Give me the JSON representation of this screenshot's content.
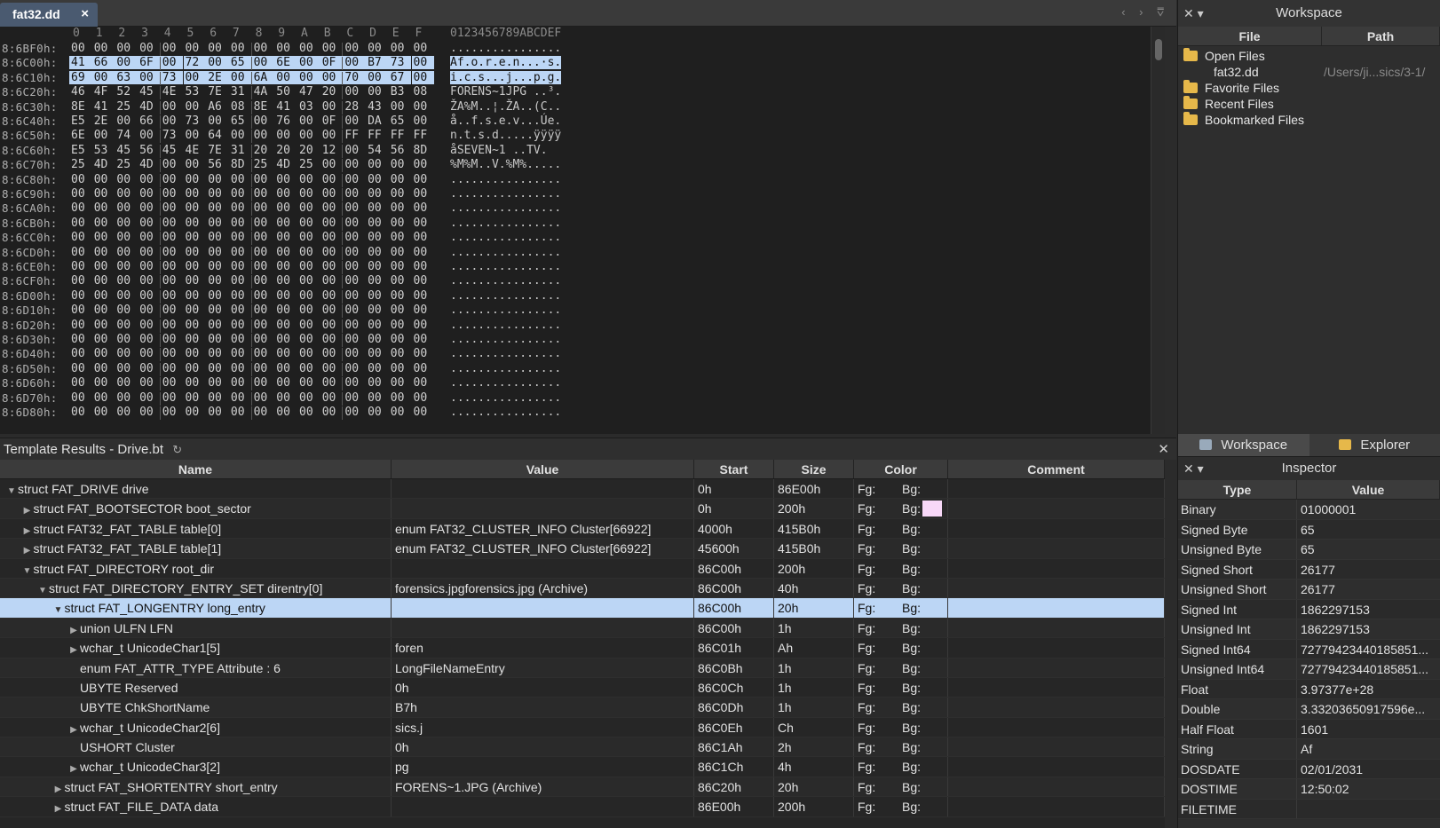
{
  "editor": {
    "tab_label": "fat32.dd",
    "tab_close": "×",
    "nav": "‹ › ⩢"
  },
  "hex": {
    "ruler": "0  1  2  3  4  5  6  7  8  9  A  B  C  D  E  F",
    "ruler_cols": [
      "0",
      "1",
      "2",
      "3",
      "4",
      "5",
      "6",
      "7",
      "8",
      "9",
      "A",
      "B",
      "C",
      "D",
      "E",
      "F"
    ],
    "ruler_ascii": "0123456789ABCDEF",
    "rows": [
      {
        "addr": "8:6BF0h:",
        "bytes": [
          "00",
          "00",
          "00",
          "00",
          "00",
          "00",
          "00",
          "00",
          "00",
          "00",
          "00",
          "00",
          "00",
          "00",
          "00",
          "00"
        ],
        "ascii": "................"
      },
      {
        "addr": "8:6C00h:",
        "bytes": [
          "41",
          "66",
          "00",
          "6F",
          "00",
          "72",
          "00",
          "65",
          "00",
          "6E",
          "00",
          "0F",
          "00",
          "B7",
          "73",
          "00"
        ],
        "ascii": "Af.o.r.e.n...·s.",
        "selected": true
      },
      {
        "addr": "8:6C10h:",
        "bytes": [
          "69",
          "00",
          "63",
          "00",
          "73",
          "00",
          "2E",
          "00",
          "6A",
          "00",
          "00",
          "00",
          "70",
          "00",
          "67",
          "00"
        ],
        "ascii": "i.c.s...j...p.g.",
        "selected": true
      },
      {
        "addr": "8:6C20h:",
        "bytes": [
          "46",
          "4F",
          "52",
          "45",
          "4E",
          "53",
          "7E",
          "31",
          "4A",
          "50",
          "47",
          "20",
          "00",
          "00",
          "B3",
          "08"
        ],
        "ascii": "FORENS~1JPG ..³."
      },
      {
        "addr": "8:6C30h:",
        "bytes": [
          "8E",
          "41",
          "25",
          "4D",
          "00",
          "00",
          "A6",
          "08",
          "8E",
          "41",
          "03",
          "00",
          "28",
          "43",
          "00",
          "00"
        ],
        "ascii": "ŽA%M..¦.ŽA..(C.."
      },
      {
        "addr": "8:6C40h:",
        "bytes": [
          "E5",
          "2E",
          "00",
          "66",
          "00",
          "73",
          "00",
          "65",
          "00",
          "76",
          "00",
          "0F",
          "00",
          "DA",
          "65",
          "00"
        ],
        "ascii": "å..f.s.e.v...Úe."
      },
      {
        "addr": "8:6C50h:",
        "bytes": [
          "6E",
          "00",
          "74",
          "00",
          "73",
          "00",
          "64",
          "00",
          "00",
          "00",
          "00",
          "00",
          "FF",
          "FF",
          "FF",
          "FF"
        ],
        "ascii": "n.t.s.d.....ÿÿÿÿ"
      },
      {
        "addr": "8:6C60h:",
        "bytes": [
          "E5",
          "53",
          "45",
          "56",
          "45",
          "4E",
          "7E",
          "31",
          "20",
          "20",
          "20",
          "12",
          "00",
          "54",
          "56",
          "8D"
        ],
        "ascii": "åSEVEN~1   ..TV."
      },
      {
        "addr": "8:6C70h:",
        "bytes": [
          "25",
          "4D",
          "25",
          "4D",
          "00",
          "00",
          "56",
          "8D",
          "25",
          "4D",
          "25",
          "00",
          "00",
          "00",
          "00",
          "00"
        ],
        "ascii": "%M%M..V.%M%....."
      },
      {
        "addr": "8:6C80h:",
        "bytes": [
          "00",
          "00",
          "00",
          "00",
          "00",
          "00",
          "00",
          "00",
          "00",
          "00",
          "00",
          "00",
          "00",
          "00",
          "00",
          "00"
        ],
        "ascii": "................"
      },
      {
        "addr": "8:6C90h:",
        "bytes": [
          "00",
          "00",
          "00",
          "00",
          "00",
          "00",
          "00",
          "00",
          "00",
          "00",
          "00",
          "00",
          "00",
          "00",
          "00",
          "00"
        ],
        "ascii": "................"
      },
      {
        "addr": "8:6CA0h:",
        "bytes": [
          "00",
          "00",
          "00",
          "00",
          "00",
          "00",
          "00",
          "00",
          "00",
          "00",
          "00",
          "00",
          "00",
          "00",
          "00",
          "00"
        ],
        "ascii": "................"
      },
      {
        "addr": "8:6CB0h:",
        "bytes": [
          "00",
          "00",
          "00",
          "00",
          "00",
          "00",
          "00",
          "00",
          "00",
          "00",
          "00",
          "00",
          "00",
          "00",
          "00",
          "00"
        ],
        "ascii": "................"
      },
      {
        "addr": "8:6CC0h:",
        "bytes": [
          "00",
          "00",
          "00",
          "00",
          "00",
          "00",
          "00",
          "00",
          "00",
          "00",
          "00",
          "00",
          "00",
          "00",
          "00",
          "00"
        ],
        "ascii": "................"
      },
      {
        "addr": "8:6CD0h:",
        "bytes": [
          "00",
          "00",
          "00",
          "00",
          "00",
          "00",
          "00",
          "00",
          "00",
          "00",
          "00",
          "00",
          "00",
          "00",
          "00",
          "00"
        ],
        "ascii": "................"
      },
      {
        "addr": "8:6CE0h:",
        "bytes": [
          "00",
          "00",
          "00",
          "00",
          "00",
          "00",
          "00",
          "00",
          "00",
          "00",
          "00",
          "00",
          "00",
          "00",
          "00",
          "00"
        ],
        "ascii": "................"
      },
      {
        "addr": "8:6CF0h:",
        "bytes": [
          "00",
          "00",
          "00",
          "00",
          "00",
          "00",
          "00",
          "00",
          "00",
          "00",
          "00",
          "00",
          "00",
          "00",
          "00",
          "00"
        ],
        "ascii": "................"
      },
      {
        "addr": "8:6D00h:",
        "bytes": [
          "00",
          "00",
          "00",
          "00",
          "00",
          "00",
          "00",
          "00",
          "00",
          "00",
          "00",
          "00",
          "00",
          "00",
          "00",
          "00"
        ],
        "ascii": "................"
      },
      {
        "addr": "8:6D10h:",
        "bytes": [
          "00",
          "00",
          "00",
          "00",
          "00",
          "00",
          "00",
          "00",
          "00",
          "00",
          "00",
          "00",
          "00",
          "00",
          "00",
          "00"
        ],
        "ascii": "................"
      },
      {
        "addr": "8:6D20h:",
        "bytes": [
          "00",
          "00",
          "00",
          "00",
          "00",
          "00",
          "00",
          "00",
          "00",
          "00",
          "00",
          "00",
          "00",
          "00",
          "00",
          "00"
        ],
        "ascii": "................"
      },
      {
        "addr": "8:6D30h:",
        "bytes": [
          "00",
          "00",
          "00",
          "00",
          "00",
          "00",
          "00",
          "00",
          "00",
          "00",
          "00",
          "00",
          "00",
          "00",
          "00",
          "00"
        ],
        "ascii": "................"
      },
      {
        "addr": "8:6D40h:",
        "bytes": [
          "00",
          "00",
          "00",
          "00",
          "00",
          "00",
          "00",
          "00",
          "00",
          "00",
          "00",
          "00",
          "00",
          "00",
          "00",
          "00"
        ],
        "ascii": "................"
      },
      {
        "addr": "8:6D50h:",
        "bytes": [
          "00",
          "00",
          "00",
          "00",
          "00",
          "00",
          "00",
          "00",
          "00",
          "00",
          "00",
          "00",
          "00",
          "00",
          "00",
          "00"
        ],
        "ascii": "................"
      },
      {
        "addr": "8:6D60h:",
        "bytes": [
          "00",
          "00",
          "00",
          "00",
          "00",
          "00",
          "00",
          "00",
          "00",
          "00",
          "00",
          "00",
          "00",
          "00",
          "00",
          "00"
        ],
        "ascii": "................"
      },
      {
        "addr": "8:6D70h:",
        "bytes": [
          "00",
          "00",
          "00",
          "00",
          "00",
          "00",
          "00",
          "00",
          "00",
          "00",
          "00",
          "00",
          "00",
          "00",
          "00",
          "00"
        ],
        "ascii": "................"
      },
      {
        "addr": "8:6D80h:",
        "bytes": [
          "00",
          "00",
          "00",
          "00",
          "00",
          "00",
          "00",
          "00",
          "00",
          "00",
          "00",
          "00",
          "00",
          "00",
          "00",
          "00"
        ],
        "ascii": "................"
      }
    ]
  },
  "workspace": {
    "title": "Workspace",
    "ctrl": "✕ ▾",
    "col_file": "File",
    "col_path": "Path",
    "items": [
      {
        "label": "Open Files",
        "icon": "folder-open-icon"
      },
      {
        "label": "fat32.dd",
        "path": "/Users/ji...sics/3-1/",
        "child": true
      },
      {
        "label": "Favorite Files",
        "icon": "folder-star-icon"
      },
      {
        "label": "Recent Files",
        "icon": "folder-recent-icon"
      },
      {
        "label": "Bookmarked Files",
        "icon": "folder-bookmark-icon"
      }
    ]
  },
  "template": {
    "title": "Template Results - Drive.bt",
    "refresh": "↻",
    "close": "✕",
    "columns": [
      "Name",
      "Value",
      "Start",
      "Size",
      "Color",
      "Comment"
    ],
    "rows": [
      {
        "indent": 0,
        "tri": "▼",
        "name": "struct FAT_DRIVE drive",
        "value": "",
        "start": "0h",
        "size": "86E00h",
        "fg": "Fg:",
        "bg": "Bg:"
      },
      {
        "indent": 1,
        "tri": "▶",
        "name": "struct FAT_BOOTSECTOR boot_sector",
        "value": "",
        "start": "0h",
        "size": "200h",
        "fg": "Fg:",
        "bg": "Bg:",
        "swatch": "#f8d8f8"
      },
      {
        "indent": 1,
        "tri": "▶",
        "name": "struct FAT32_FAT_TABLE table[0]",
        "value": "enum FAT32_CLUSTER_INFO Cluster[66922]",
        "start": "4000h",
        "size": "415B0h",
        "fg": "Fg:",
        "bg": "Bg:"
      },
      {
        "indent": 1,
        "tri": "▶",
        "name": "struct FAT32_FAT_TABLE table[1]",
        "value": "enum FAT32_CLUSTER_INFO Cluster[66922]",
        "start": "45600h",
        "size": "415B0h",
        "fg": "Fg:",
        "bg": "Bg:"
      },
      {
        "indent": 1,
        "tri": "▼",
        "name": "struct FAT_DIRECTORY root_dir",
        "value": "",
        "start": "86C00h",
        "size": "200h",
        "fg": "Fg:",
        "bg": "Bg:"
      },
      {
        "indent": 2,
        "tri": "▼",
        "name": "struct FAT_DIRECTORY_ENTRY_SET direntry[0]",
        "value": "forensics.jpgforensics.jpg (Archive)",
        "start": "86C00h",
        "size": "40h",
        "fg": "Fg:",
        "bg": "Bg:"
      },
      {
        "indent": 3,
        "tri": "▼",
        "name": "struct FAT_LONGENTRY long_entry",
        "value": "",
        "start": "86C00h",
        "size": "20h",
        "fg": "Fg:",
        "bg": "Bg:",
        "selected": true
      },
      {
        "indent": 4,
        "tri": "▶",
        "name": "union ULFN LFN",
        "value": "",
        "start": "86C00h",
        "size": "1h",
        "fg": "Fg:",
        "bg": "Bg:"
      },
      {
        "indent": 4,
        "tri": "▶",
        "name": "wchar_t UnicodeChar1[5]",
        "value": "foren",
        "start": "86C01h",
        "size": "Ah",
        "fg": "Fg:",
        "bg": "Bg:"
      },
      {
        "indent": 4,
        "tri": "",
        "name": "enum FAT_ATTR_TYPE Attribute : 6",
        "value": "LongFileNameEntry",
        "start": "86C0Bh",
        "size": "1h",
        "fg": "Fg:",
        "bg": "Bg:"
      },
      {
        "indent": 4,
        "tri": "",
        "name": "UBYTE Reserved",
        "value": "0h",
        "start": "86C0Ch",
        "size": "1h",
        "fg": "Fg:",
        "bg": "Bg:"
      },
      {
        "indent": 4,
        "tri": "",
        "name": "UBYTE ChkShortName",
        "value": "B7h",
        "start": "86C0Dh",
        "size": "1h",
        "fg": "Fg:",
        "bg": "Bg:"
      },
      {
        "indent": 4,
        "tri": "▶",
        "name": "wchar_t UnicodeChar2[6]",
        "value": "sics.j",
        "start": "86C0Eh",
        "size": "Ch",
        "fg": "Fg:",
        "bg": "Bg:"
      },
      {
        "indent": 4,
        "tri": "",
        "name": "USHORT Cluster",
        "value": "0h",
        "start": "86C1Ah",
        "size": "2h",
        "fg": "Fg:",
        "bg": "Bg:"
      },
      {
        "indent": 4,
        "tri": "▶",
        "name": "wchar_t UnicodeChar3[2]",
        "value": "pg",
        "start": "86C1Ch",
        "size": "4h",
        "fg": "Fg:",
        "bg": "Bg:"
      },
      {
        "indent": 3,
        "tri": "▶",
        "name": "struct FAT_SHORTENTRY short_entry",
        "value": "FORENS~1.JPG (Archive)",
        "start": "86C20h",
        "size": "20h",
        "fg": "Fg:",
        "bg": "Bg:"
      },
      {
        "indent": 3,
        "tri": "▶",
        "name": "struct FAT_FILE_DATA data",
        "value": "",
        "start": "86E00h",
        "size": "200h",
        "fg": "Fg:",
        "bg": "Bg:"
      }
    ]
  },
  "lower_tabs": [
    {
      "label": "Workspace",
      "icon": "workspace-icon",
      "active": true
    },
    {
      "label": "Explorer",
      "icon": "folder-icon",
      "active": false
    }
  ],
  "inspector": {
    "title": "Inspector",
    "ctrl": "✕ ▾",
    "col_type": "Type",
    "col_value": "Value",
    "rows": [
      {
        "type": "Binary",
        "value": "01000001"
      },
      {
        "type": "Signed Byte",
        "value": "65"
      },
      {
        "type": "Unsigned Byte",
        "value": "65"
      },
      {
        "type": "Signed Short",
        "value": "26177"
      },
      {
        "type": "Unsigned Short",
        "value": "26177"
      },
      {
        "type": "Signed Int",
        "value": "1862297153"
      },
      {
        "type": "Unsigned Int",
        "value": "1862297153"
      },
      {
        "type": "Signed Int64",
        "value": "72779423440185851..."
      },
      {
        "type": "Unsigned Int64",
        "value": "72779423440185851..."
      },
      {
        "type": "Float",
        "value": "3.97377e+28"
      },
      {
        "type": "Double",
        "value": "3.33203650917596e..."
      },
      {
        "type": "Half Float",
        "value": "1601"
      },
      {
        "type": "String",
        "value": "Af"
      },
      {
        "type": "DOSDATE",
        "value": "02/01/2031"
      },
      {
        "type": "DOSTIME",
        "value": "12:50:02"
      },
      {
        "type": "FILETIME",
        "value": ""
      }
    ]
  }
}
